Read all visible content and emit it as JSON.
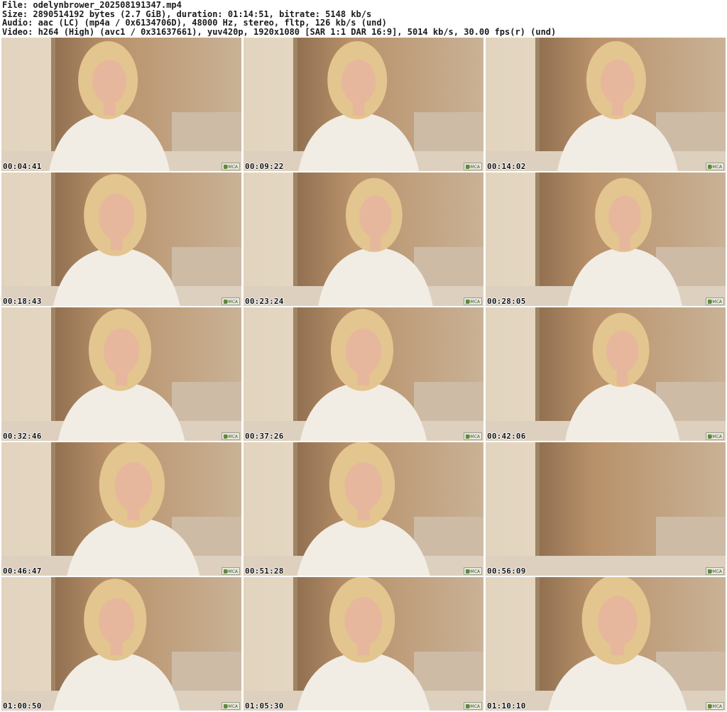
{
  "info": {
    "file": "File: odelynbrower_202508191347.mp4",
    "size": "Size: 2890514192 bytes (2.7 GiB), duration: 01:14:51, bitrate: 5148 kb/s",
    "audio": "Audio: aac (LC) (mp4a / 0x6134706D), 48000 Hz, stereo, fltp, 126 kb/s (und)",
    "video": "Video: h264 (High) (avc1 / 0x31637661), yuv420p, 1920x1080 [SAR 1:1 DAR 16:9], 5014 kb/s, 30.00 fps(r) (und)"
  },
  "thumbnails": [
    {
      "time": "00:04:41"
    },
    {
      "time": "00:09:22"
    },
    {
      "time": "00:14:02"
    },
    {
      "time": "00:18:43"
    },
    {
      "time": "00:23:24"
    },
    {
      "time": "00:28:05"
    },
    {
      "time": "00:32:46"
    },
    {
      "time": "00:37:26"
    },
    {
      "time": "00:42:06"
    },
    {
      "time": "00:46:47"
    },
    {
      "time": "00:51:28"
    },
    {
      "time": "00:56:09"
    },
    {
      "time": "01:00:50"
    },
    {
      "time": "01:05:30"
    },
    {
      "time": "01:10:10"
    }
  ],
  "badge": {
    "label": "DMCA"
  },
  "colors": {
    "wall_warm": "#b8916a",
    "wall_shadow": "#6b5038",
    "curtain": "#ecdfcb",
    "headboard": "#cdbba6",
    "bed": "#ddd0bf",
    "shirt": "#f2ede4",
    "hair": "#e3c58f",
    "skin": "#e6b79c"
  },
  "icons": {
    "badge_icon": "lock-icon"
  }
}
